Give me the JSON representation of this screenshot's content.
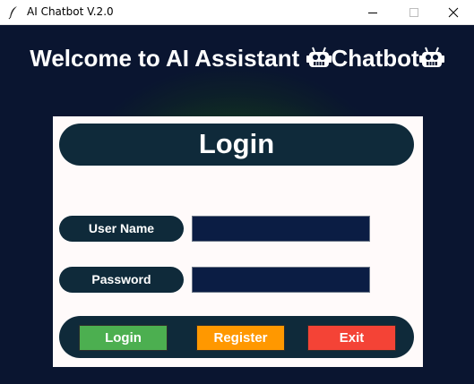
{
  "window": {
    "title": "AI Chatbot V.2.0",
    "icon": "feather-icon",
    "controls": [
      "minimize-icon",
      "maximize-icon",
      "close-icon"
    ]
  },
  "banner": {
    "text": "Welcome to AI Assistant ",
    "text2": "Chatbot",
    "emoji": "robot-face-icon"
  },
  "login": {
    "title": "Login",
    "username_label": "User Name",
    "password_label": "Password",
    "username_value": "",
    "password_value": ""
  },
  "buttons": {
    "login": "Login",
    "register": "Register",
    "exit": "Exit"
  },
  "colors": {
    "background": "#0a1530",
    "card": "#fffafa",
    "pill": "#0f2a3a",
    "field": "#0b1d44",
    "login_button": "#4caf50",
    "register_button": "#ff9800",
    "exit_button": "#f44336"
  }
}
